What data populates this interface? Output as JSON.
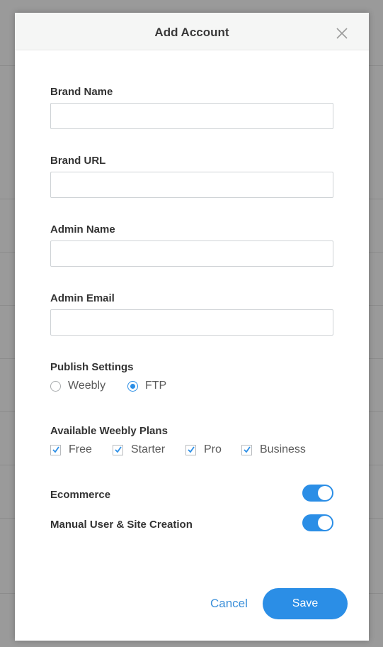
{
  "dialog": {
    "title": "Add Account",
    "close_icon": "close-icon"
  },
  "fields": [
    {
      "label": "Brand Name",
      "value": "",
      "placeholder": ""
    },
    {
      "label": "Brand URL",
      "value": "",
      "placeholder": ""
    },
    {
      "label": "Admin Name",
      "value": "",
      "placeholder": ""
    },
    {
      "label": "Admin Email",
      "value": "",
      "placeholder": ""
    }
  ],
  "publish_settings": {
    "label": "Publish Settings",
    "options": [
      {
        "label": "Weebly",
        "selected": false
      },
      {
        "label": "FTP",
        "selected": true
      }
    ]
  },
  "plans": {
    "label": "Available Weebly Plans",
    "options": [
      {
        "label": "Free",
        "checked": true
      },
      {
        "label": "Starter",
        "checked": true
      },
      {
        "label": "Pro",
        "checked": true
      },
      {
        "label": "Business",
        "checked": true
      }
    ]
  },
  "toggles": [
    {
      "label": "Ecommerce",
      "on": true
    },
    {
      "label": "Manual User & Site Creation",
      "on": true
    }
  ],
  "footer": {
    "cancel_label": "Cancel",
    "save_label": "Save"
  },
  "colors": {
    "accent": "#2b8ee6",
    "overlay": "#9a9a9a",
    "header_bg": "#f5f6f5"
  }
}
